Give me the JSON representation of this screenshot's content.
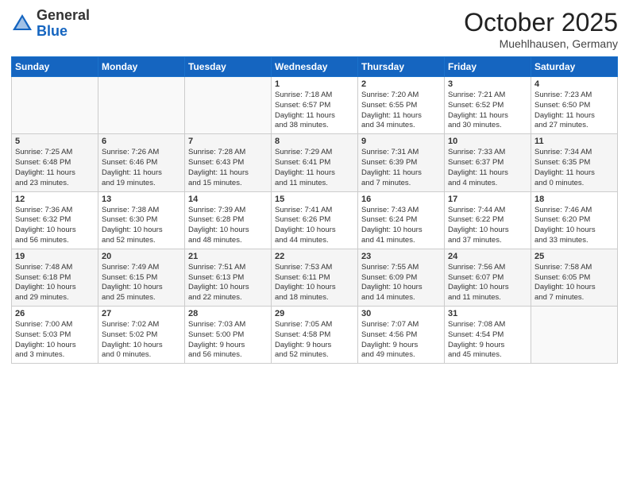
{
  "header": {
    "logo_general": "General",
    "logo_blue": "Blue",
    "month_title": "October 2025",
    "location": "Muehlhausen, Germany"
  },
  "weekdays": [
    "Sunday",
    "Monday",
    "Tuesday",
    "Wednesday",
    "Thursday",
    "Friday",
    "Saturday"
  ],
  "weeks": [
    [
      {
        "day": "",
        "info": ""
      },
      {
        "day": "",
        "info": ""
      },
      {
        "day": "",
        "info": ""
      },
      {
        "day": "1",
        "info": "Sunrise: 7:18 AM\nSunset: 6:57 PM\nDaylight: 11 hours\nand 38 minutes."
      },
      {
        "day": "2",
        "info": "Sunrise: 7:20 AM\nSunset: 6:55 PM\nDaylight: 11 hours\nand 34 minutes."
      },
      {
        "day": "3",
        "info": "Sunrise: 7:21 AM\nSunset: 6:52 PM\nDaylight: 11 hours\nand 30 minutes."
      },
      {
        "day": "4",
        "info": "Sunrise: 7:23 AM\nSunset: 6:50 PM\nDaylight: 11 hours\nand 27 minutes."
      }
    ],
    [
      {
        "day": "5",
        "info": "Sunrise: 7:25 AM\nSunset: 6:48 PM\nDaylight: 11 hours\nand 23 minutes."
      },
      {
        "day": "6",
        "info": "Sunrise: 7:26 AM\nSunset: 6:46 PM\nDaylight: 11 hours\nand 19 minutes."
      },
      {
        "day": "7",
        "info": "Sunrise: 7:28 AM\nSunset: 6:43 PM\nDaylight: 11 hours\nand 15 minutes."
      },
      {
        "day": "8",
        "info": "Sunrise: 7:29 AM\nSunset: 6:41 PM\nDaylight: 11 hours\nand 11 minutes."
      },
      {
        "day": "9",
        "info": "Sunrise: 7:31 AM\nSunset: 6:39 PM\nDaylight: 11 hours\nand 7 minutes."
      },
      {
        "day": "10",
        "info": "Sunrise: 7:33 AM\nSunset: 6:37 PM\nDaylight: 11 hours\nand 4 minutes."
      },
      {
        "day": "11",
        "info": "Sunrise: 7:34 AM\nSunset: 6:35 PM\nDaylight: 11 hours\nand 0 minutes."
      }
    ],
    [
      {
        "day": "12",
        "info": "Sunrise: 7:36 AM\nSunset: 6:32 PM\nDaylight: 10 hours\nand 56 minutes."
      },
      {
        "day": "13",
        "info": "Sunrise: 7:38 AM\nSunset: 6:30 PM\nDaylight: 10 hours\nand 52 minutes."
      },
      {
        "day": "14",
        "info": "Sunrise: 7:39 AM\nSunset: 6:28 PM\nDaylight: 10 hours\nand 48 minutes."
      },
      {
        "day": "15",
        "info": "Sunrise: 7:41 AM\nSunset: 6:26 PM\nDaylight: 10 hours\nand 44 minutes."
      },
      {
        "day": "16",
        "info": "Sunrise: 7:43 AM\nSunset: 6:24 PM\nDaylight: 10 hours\nand 41 minutes."
      },
      {
        "day": "17",
        "info": "Sunrise: 7:44 AM\nSunset: 6:22 PM\nDaylight: 10 hours\nand 37 minutes."
      },
      {
        "day": "18",
        "info": "Sunrise: 7:46 AM\nSunset: 6:20 PM\nDaylight: 10 hours\nand 33 minutes."
      }
    ],
    [
      {
        "day": "19",
        "info": "Sunrise: 7:48 AM\nSunset: 6:18 PM\nDaylight: 10 hours\nand 29 minutes."
      },
      {
        "day": "20",
        "info": "Sunrise: 7:49 AM\nSunset: 6:15 PM\nDaylight: 10 hours\nand 25 minutes."
      },
      {
        "day": "21",
        "info": "Sunrise: 7:51 AM\nSunset: 6:13 PM\nDaylight: 10 hours\nand 22 minutes."
      },
      {
        "day": "22",
        "info": "Sunrise: 7:53 AM\nSunset: 6:11 PM\nDaylight: 10 hours\nand 18 minutes."
      },
      {
        "day": "23",
        "info": "Sunrise: 7:55 AM\nSunset: 6:09 PM\nDaylight: 10 hours\nand 14 minutes."
      },
      {
        "day": "24",
        "info": "Sunrise: 7:56 AM\nSunset: 6:07 PM\nDaylight: 10 hours\nand 11 minutes."
      },
      {
        "day": "25",
        "info": "Sunrise: 7:58 AM\nSunset: 6:05 PM\nDaylight: 10 hours\nand 7 minutes."
      }
    ],
    [
      {
        "day": "26",
        "info": "Sunrise: 7:00 AM\nSunset: 5:03 PM\nDaylight: 10 hours\nand 3 minutes."
      },
      {
        "day": "27",
        "info": "Sunrise: 7:02 AM\nSunset: 5:02 PM\nDaylight: 10 hours\nand 0 minutes."
      },
      {
        "day": "28",
        "info": "Sunrise: 7:03 AM\nSunset: 5:00 PM\nDaylight: 9 hours\nand 56 minutes."
      },
      {
        "day": "29",
        "info": "Sunrise: 7:05 AM\nSunset: 4:58 PM\nDaylight: 9 hours\nand 52 minutes."
      },
      {
        "day": "30",
        "info": "Sunrise: 7:07 AM\nSunset: 4:56 PM\nDaylight: 9 hours\nand 49 minutes."
      },
      {
        "day": "31",
        "info": "Sunrise: 7:08 AM\nSunset: 4:54 PM\nDaylight: 9 hours\nand 45 minutes."
      },
      {
        "day": "",
        "info": ""
      }
    ]
  ]
}
